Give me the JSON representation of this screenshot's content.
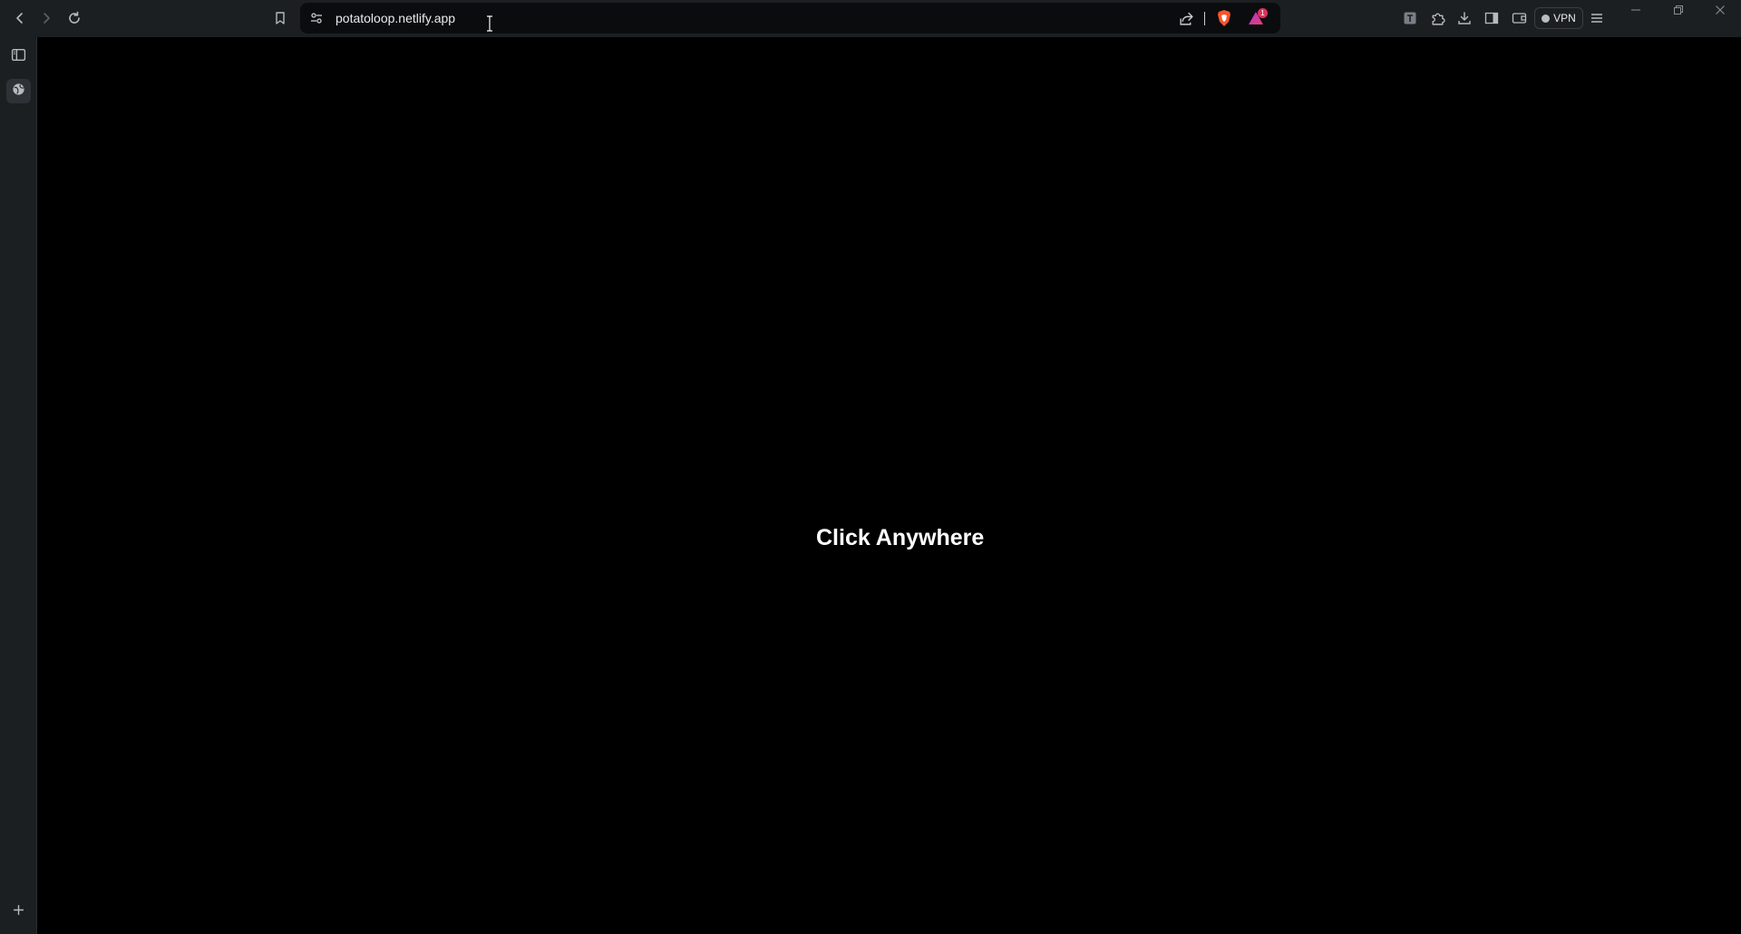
{
  "browser": {
    "url": "potatoloop.netlify.app",
    "rewards_badge": "1",
    "vpn_label": "VPN",
    "accent_color": "#e0305b",
    "icons": {
      "back": "chevron-left-icon",
      "forward": "chevron-right-icon",
      "reload": "reload-icon",
      "bookmark": "bookmark-icon",
      "site_info": "tune-icon",
      "share": "share-icon",
      "shields": "brave-shield-icon",
      "rewards": "rewards-triangle-icon",
      "translate": "translate-icon",
      "extensions": "puzzle-icon",
      "downloads": "download-icon",
      "sidepanel": "sidepanel-icon",
      "wallet": "wallet-icon",
      "menu": "hamburger-menu-icon",
      "minimize": "minimize-icon",
      "restore": "restore-icon",
      "close": "close-icon"
    }
  },
  "sidebar": {
    "icons": [
      "sidebar-toggle-icon",
      "globe-icon",
      "plus-icon"
    ]
  },
  "page": {
    "message": "Click Anywhere",
    "background_color": "#000000"
  }
}
